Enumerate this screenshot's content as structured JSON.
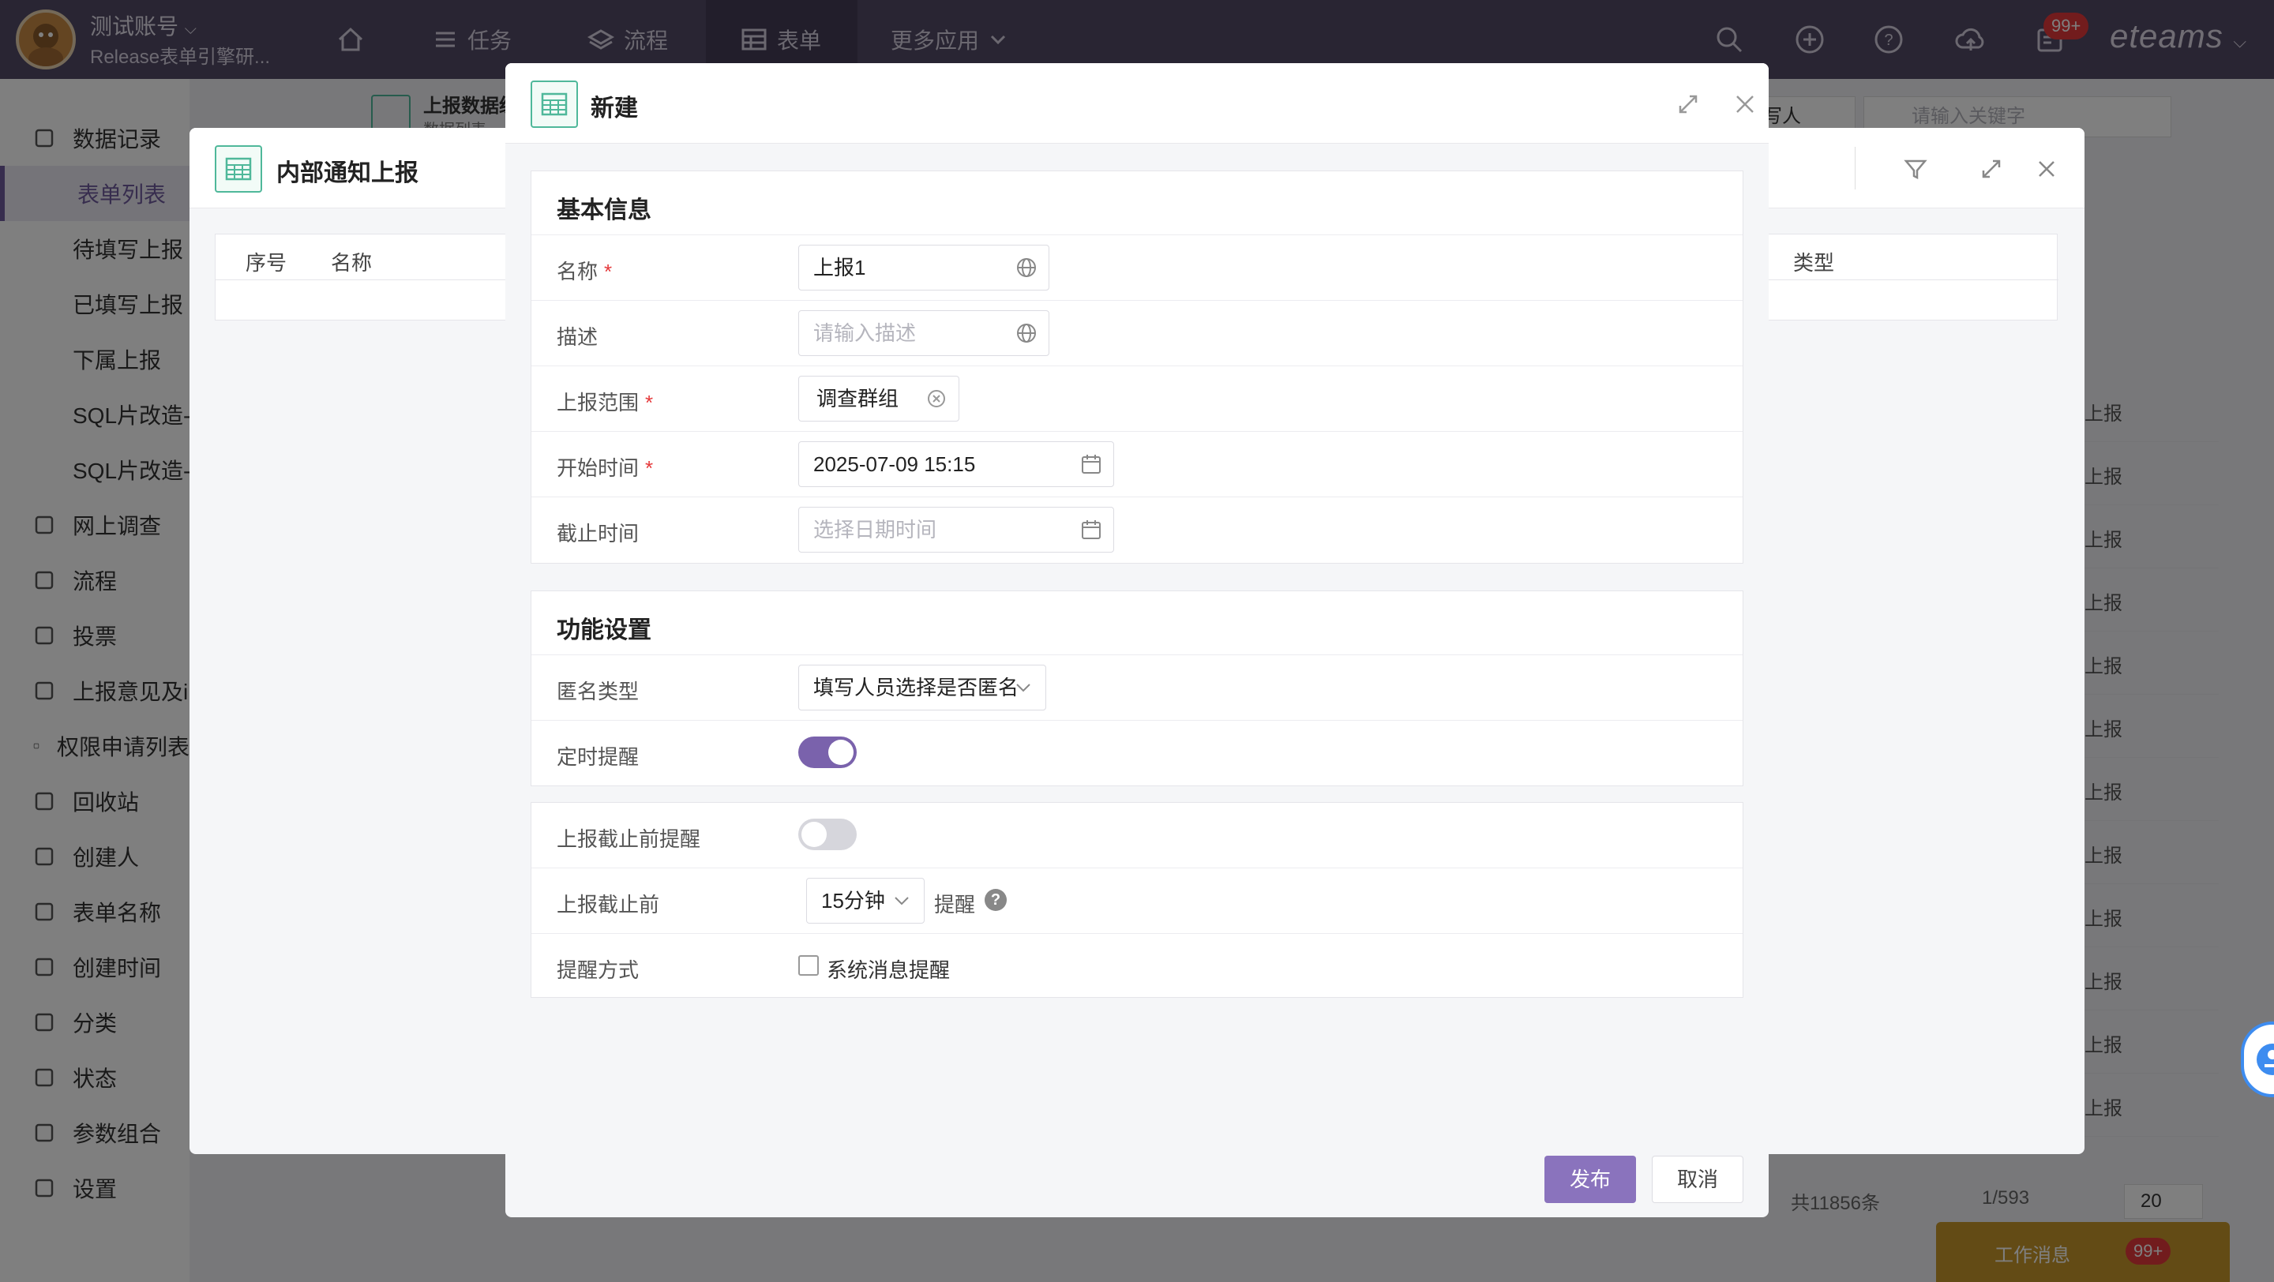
{
  "header": {
    "account_name": "测试账号",
    "account_sub": "Release表单引擎研...",
    "nav": [
      {
        "label": "任务"
      },
      {
        "label": "流程"
      },
      {
        "label": "表单"
      },
      {
        "label": "更多应用"
      }
    ],
    "badge": "99+",
    "brand": "eteams"
  },
  "sidebar": {
    "items": [
      {
        "label": "数据记录",
        "icon": "document-icon"
      },
      {
        "label": "表单列表"
      },
      {
        "label": "待填写上报"
      },
      {
        "label": "已填写上报"
      },
      {
        "label": "下属上报"
      },
      {
        "label": "SQL片改造-"
      },
      {
        "label": "SQL片改造-"
      },
      {
        "label": "网上调查",
        "icon": "edit-icon"
      },
      {
        "label": "流程",
        "icon": "flow-icon"
      },
      {
        "label": "投票",
        "icon": "vote-icon"
      },
      {
        "label": "上报意见及i",
        "icon": "opinion-icon"
      },
      {
        "label": "权限申请列表",
        "icon": "layers-icon"
      },
      {
        "label": "回收站",
        "icon": "trash-icon"
      },
      {
        "label": "创建人",
        "icon": "at-icon"
      },
      {
        "label": "表单名称",
        "icon": "table-icon"
      },
      {
        "label": "创建时间",
        "icon": "chart-icon"
      },
      {
        "label": "分类",
        "icon": "cloud-icon"
      },
      {
        "label": "状态",
        "icon": "check-icon"
      },
      {
        "label": "参数组合",
        "icon": "users-icon"
      },
      {
        "label": "设置",
        "icon": "gear-icon"
      }
    ]
  },
  "background": {
    "header_title": "上报数据统",
    "header_sub": "数据列表",
    "writer_label": "写人",
    "search_placeholder": "请输入关键字",
    "type_col": "类型",
    "row_text": "上报",
    "pager_total": "共11856条",
    "pager_page": "1/593",
    "pager_size": "20",
    "work_msg": "工作消息",
    "work_badge": "99+"
  },
  "modal2": {
    "title": "内部通知上报",
    "search_placeholder": "键字",
    "col_index": "序号",
    "col_name": "名称"
  },
  "modal": {
    "title": "新建",
    "basic_section": "基本信息",
    "fields": {
      "name": {
        "label": "名称",
        "value": "上报1"
      },
      "desc": {
        "label": "描述",
        "placeholder": "请输入描述"
      },
      "scope": {
        "label": "上报范围",
        "tag": "调查群组"
      },
      "start": {
        "label": "开始时间",
        "value": "2025-07-09 15:15"
      },
      "end": {
        "label": "截止时间",
        "placeholder": "选择日期时间"
      }
    },
    "func_section": "功能设置",
    "anon": {
      "label": "匿名类型",
      "value": "填写人员选择是否匿名"
    },
    "timer": {
      "label": "定时提醒",
      "on": true
    },
    "deadline_remind": {
      "label": "上报截止前提醒",
      "on": false
    },
    "before": {
      "label": "上报截止前",
      "value": "15分钟",
      "suffix": "提醒"
    },
    "method": {
      "label": "提醒方式",
      "option": "系统消息提醒"
    },
    "publish": "发布",
    "cancel": "取消",
    "accent": "#8a73bd"
  }
}
